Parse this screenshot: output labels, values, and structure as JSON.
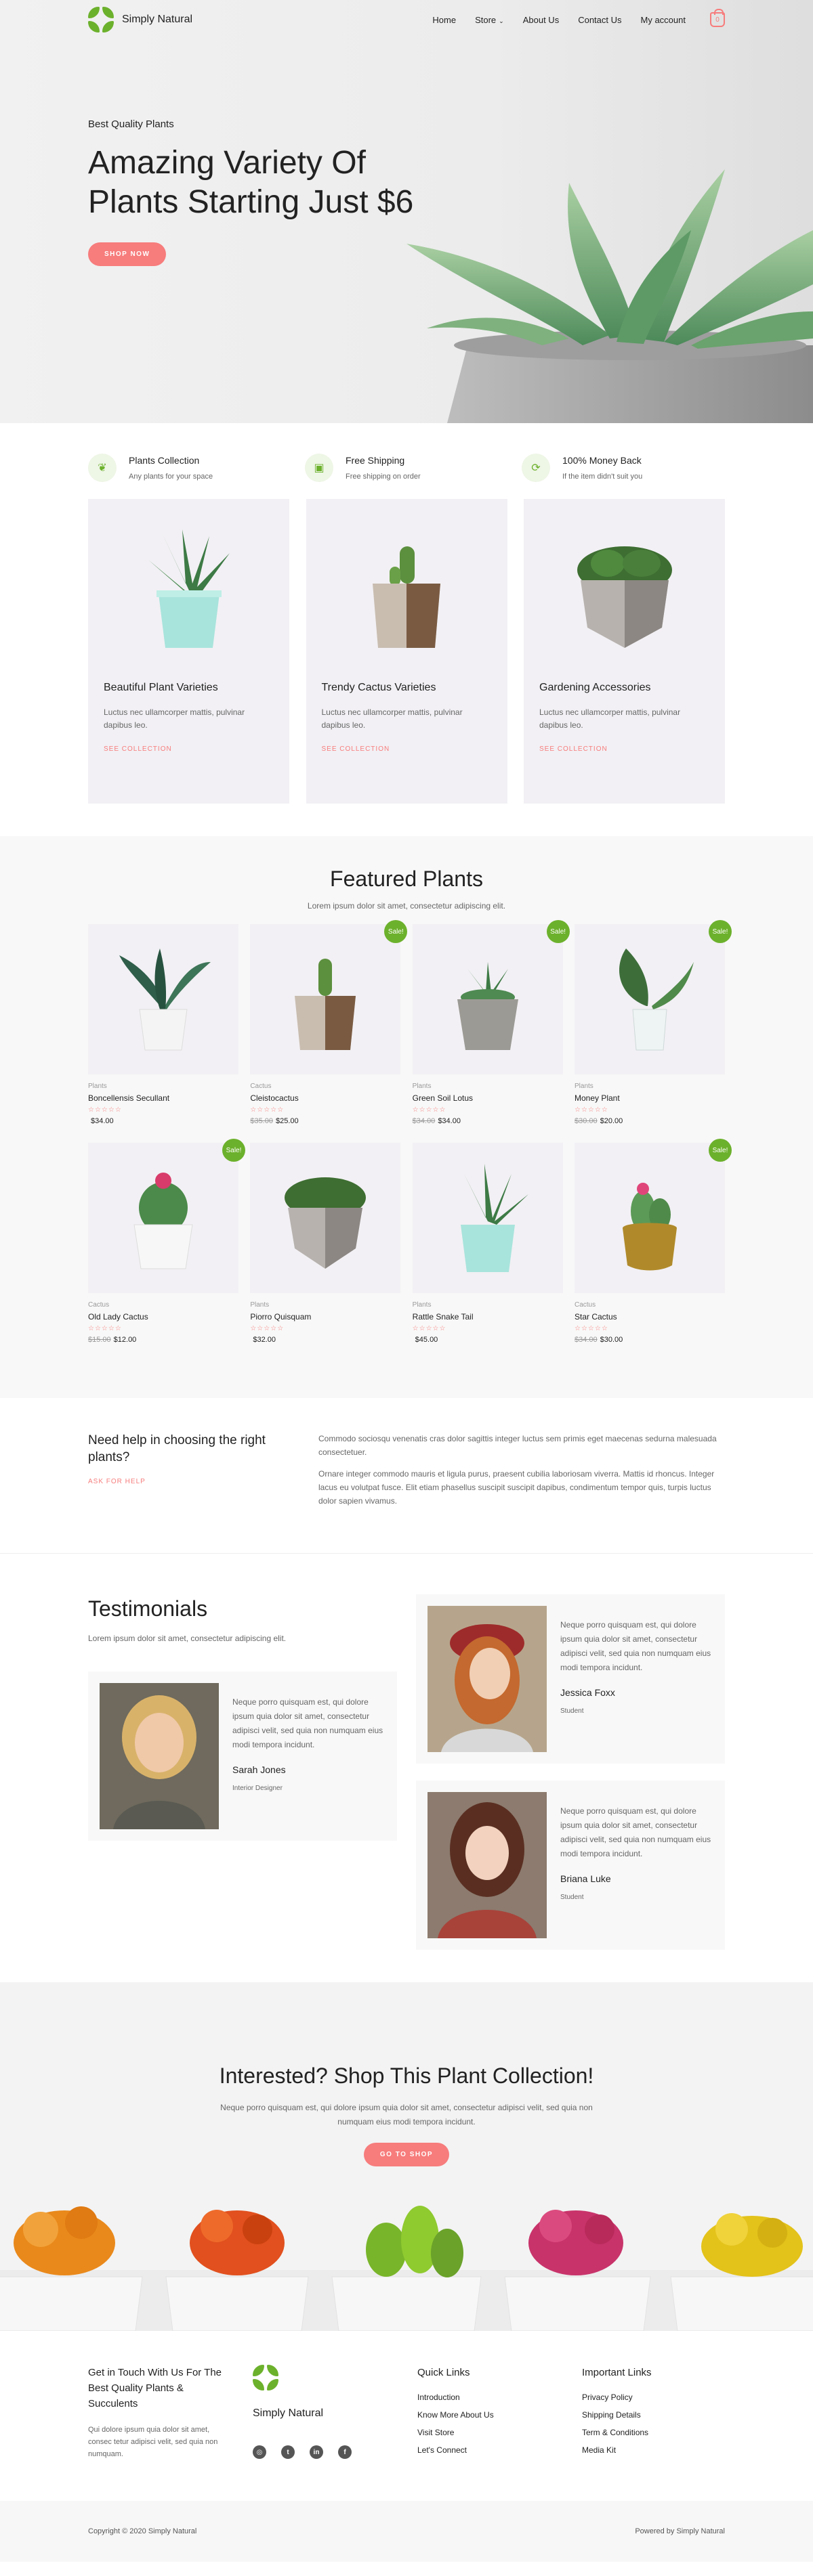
{
  "brand": {
    "name": "Simply Natural",
    "accent": "#6cb12c",
    "coral": "#f77c7c"
  },
  "nav": {
    "home": "Home",
    "store": "Store",
    "about": "About Us",
    "contact": "Contact Us",
    "account": "My account",
    "cart_count": "0"
  },
  "hero": {
    "kicker": "Best Quality Plants",
    "title": "Amazing Variety Of Plants Starting Just $6",
    "button": "SHOP NOW"
  },
  "features": [
    {
      "title": "Plants Collection",
      "sub": "Any plants for your space",
      "icon": "plant-icon"
    },
    {
      "title": "Free Shipping",
      "sub": "Free shipping on order",
      "icon": "gift-icon"
    },
    {
      "title": "100% Money Back",
      "sub": "If the item didn't suit you",
      "icon": "refresh-icon"
    }
  ],
  "cards": [
    {
      "title": "Beautiful Plant Varieties",
      "desc": "Luctus nec ullamcorper mattis, pulvinar dapibus leo.",
      "link": "SEE COLLECTION"
    },
    {
      "title": "Trendy Cactus Varieties",
      "desc": "Luctus nec ullamcorper mattis, pulvinar dapibus leo.",
      "link": "SEE COLLECTION"
    },
    {
      "title": "Gardening Accessories",
      "desc": "Luctus nec ullamcorper mattis, pulvinar dapibus leo.",
      "link": "SEE COLLECTION"
    }
  ],
  "featured": {
    "title": "Featured Plants",
    "sub": "Lorem ipsum dolor sit amet, consectetur adipiscing elit.",
    "sale_label": "Sale!",
    "stars": "☆☆☆☆☆",
    "products": [
      {
        "cat": "Plants",
        "name": "Boncellensis Secullant",
        "old": "",
        "price": "$34.00"
      },
      {
        "cat": "Cactus",
        "name": "Cleistocactus",
        "old": "$35.00",
        "price": "$25.00"
      },
      {
        "cat": "Plants",
        "name": "Green Soil Lotus",
        "old": "$34.00",
        "price": "$34.00"
      },
      {
        "cat": "Plants",
        "name": "Money Plant",
        "old": "$30.00",
        "price": "$20.00"
      },
      {
        "cat": "Cactus",
        "name": "Old Lady Cactus",
        "old": "$15.00",
        "price": "$12.00"
      },
      {
        "cat": "Plants",
        "name": "Piorro Quisquam",
        "old": "",
        "price": "$32.00"
      },
      {
        "cat": "Plants",
        "name": "Rattle Snake Tail",
        "old": "",
        "price": "$45.00"
      },
      {
        "cat": "Cactus",
        "name": "Star Cactus",
        "old": "$34.00",
        "price": "$30.00"
      }
    ]
  },
  "help": {
    "title": "Need help in choosing the right plants?",
    "link": "ASK FOR HELP",
    "p1": "Commodo sociosqu venenatis cras dolor sagittis integer luctus sem primis eget maecenas sedurna malesuada consectetuer.",
    "p2": "Ornare integer commodo mauris et ligula purus, praesent cubilia laboriosam viverra. Mattis id rhoncus. Integer lacus eu volutpat fusce. Elit etiam phasellus suscipit suscipit dapibus, condimentum tempor quis, turpis luctus dolor sapien vivamus."
  },
  "testimonials": {
    "title": "Testimonials",
    "sub": "Lorem ipsum dolor sit amet, consectetur adipiscing elit.",
    "items": [
      {
        "quote": "Neque porro quisquam est, qui dolore ipsum quia dolor sit amet, consectetur adipisci velit, sed quia non numquam eius modi tempora incidunt.",
        "name": "Sarah Jones",
        "role": "Interior Designer"
      },
      {
        "quote": "Neque porro quisquam est, qui dolore ipsum quia dolor sit amet, consectetur adipisci velit, sed quia non numquam eius modi tempora incidunt.",
        "name": "Jessica Foxx",
        "role": "Student"
      },
      {
        "quote": "Neque porro quisquam est, qui dolore ipsum quia dolor sit amet, consectetur adipisci velit, sed quia non numquam eius modi tempora incidunt.",
        "name": "Briana Luke",
        "role": "Student"
      }
    ]
  },
  "cta": {
    "title": "Interested? Shop This Plant Collection!",
    "sub": "Neque porro quisquam est, qui dolore ipsum quia dolor sit amet, consectetur adipisci velit, sed quia non numquam eius modi tempora incidunt.",
    "button": "GO TO SHOP"
  },
  "footer": {
    "heading": "Get in Touch With Us For The Best Quality Plants & Succulents",
    "text": "Qui dolore ipsum quia dolor sit amet, consec tetur adipisci velit, sed quia non numquam.",
    "logo_text": "Simply Natural",
    "quick_title": "Quick Links",
    "quick": [
      "Introduction",
      "Know More About Us",
      "Visit Store",
      "Let's Connect"
    ],
    "important_title": "Important Links",
    "important": [
      "Privacy Policy",
      "Shipping Details",
      "Term & Conditions",
      "Media Kit"
    ],
    "copyright": "Copyright © 2020 Simply Natural",
    "powered": "Powered by Simply Natural"
  }
}
